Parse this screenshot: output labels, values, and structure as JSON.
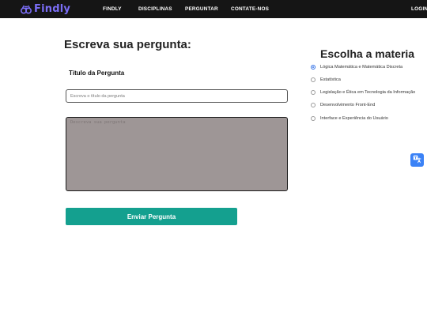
{
  "nav": {
    "logo_text": "Findly",
    "links": [
      "FINDLY",
      "DISCIPLINAS",
      "PERGUNTAR",
      "CONTATE-NOS"
    ],
    "login_label": "LOGIN O"
  },
  "form": {
    "heading": "Escreva sua pergunta:",
    "title_label": "Título da Pergunta",
    "title_placeholder": "Escreva o título da pergunta",
    "question_placeholder": "Descreva sua pergunta",
    "submit_label": "Enviar Pergunta"
  },
  "subjects": {
    "heading": "Escolha a materia",
    "selected_index": 0,
    "items": [
      "Lógica Matemática e Matemática Discreta",
      "Estatística",
      "Legislação e Ética em Tecnologia da Informação",
      "Desenvolvimento Front-End",
      "Interface e Experiência do Usuário"
    ]
  },
  "colors": {
    "nav_bg": "#151515",
    "logo": "#7b6ef6",
    "submit": "#14a08f",
    "textarea_bg": "#9e9696",
    "radio_selected": "#2f6fe6",
    "translate_button": "#3b82f6"
  },
  "icons": {
    "logo": "binoculars-icon",
    "translate": "translate-icon"
  }
}
